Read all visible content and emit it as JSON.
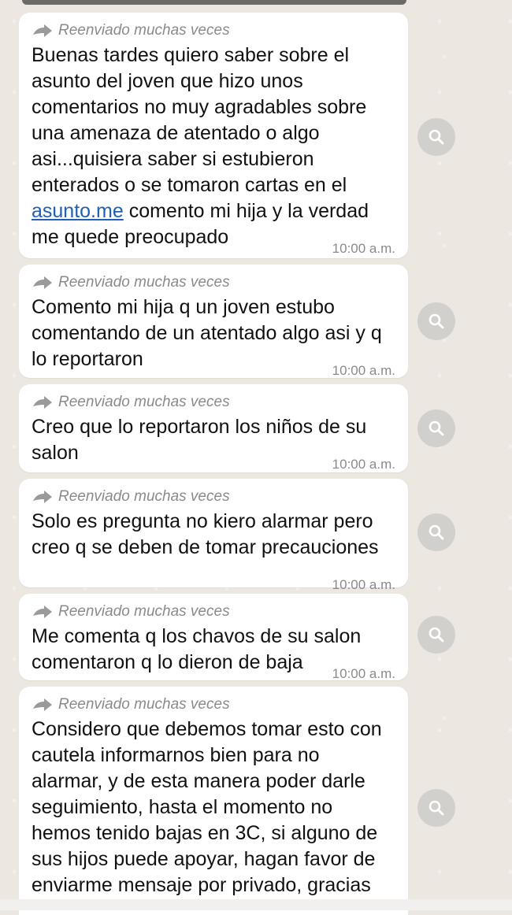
{
  "forward_label": "Reenviado muchas veces",
  "messages": [
    {
      "text_before": "Buenas tardes quiero saber sobre el asunto del joven que hizo unos comentarios no muy agradables sobre una amenaza de atentado o algo asi...quisiera saber si estubieron enterados o se tomaron cartas en el ",
      "link": "asunto.me",
      "text_after": " comento mi hija y la verdad me quede preocupado",
      "time": "10:00 a.m."
    },
    {
      "text_before": "Comento mi hija q un joven estubo comentando de un atentado algo asi y q lo reportaron",
      "time": "10:00 a.m."
    },
    {
      "text_before": "Creo que lo reportaron los niños de su salon",
      "time": "10:00 a.m."
    },
    {
      "text_before": "Solo es pregunta no kiero alarmar pero creo q se deben de tomar precauciones",
      "time": "10:00 a.m."
    },
    {
      "text_before": "Me comenta q los chavos de su salon comentaron q lo dieron de baja",
      "time": "10:00 a.m."
    },
    {
      "text_before": "Considero que debemos tomar esto con cautela informarnos bien para no alarmar, y de esta manera poder darle seguimiento, hasta el momento no hemos tenido bajas en 3C, si alguno de sus hijos puede apoyar, hagan favor de enviarme mensaje por privado, gracias"
    }
  ],
  "icons": {
    "forward": "forward-arrow-icon",
    "search": "search-icon"
  },
  "colors": {
    "background": "#ece7e1",
    "bubble": "#ffffff",
    "link": "#1f5fb5",
    "meta_text": "#8a8a8a"
  }
}
